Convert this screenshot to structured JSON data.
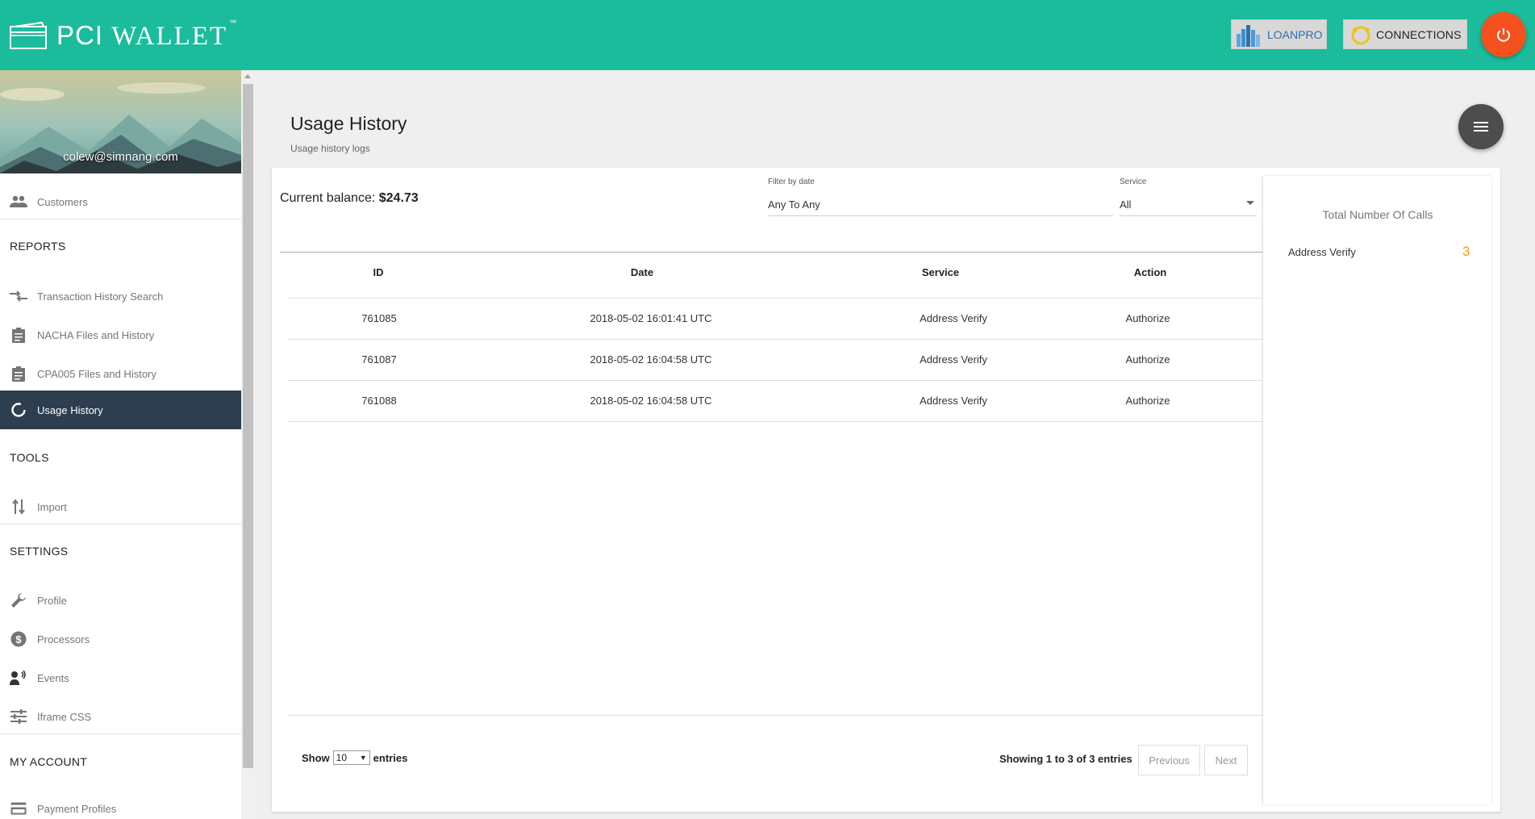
{
  "app": {
    "logo_text_a": "PCI",
    "logo_text_b": "WALLET",
    "logo_tm": "™"
  },
  "topbar": {
    "loanpro_label": "LOANPRO",
    "connections_label": "CONNECTIONS",
    "power_icon": "power-icon",
    "colors": {
      "bar": "#1abc9c",
      "power": "#f4511e"
    }
  },
  "sidebar": {
    "email": "colew@simnang.com",
    "items": {
      "customers": "Customers",
      "reports_head": "REPORTS",
      "transaction_history": "Transaction History Search",
      "nacha": "NACHA Files and History",
      "cpa005": "CPA005 Files and History",
      "usage_history": "Usage History",
      "tools_head": "TOOLS",
      "import": "Import",
      "settings_head": "SETTINGS",
      "profile": "Profile",
      "processors": "Processors",
      "events": "Events",
      "iframe_css": "Iframe CSS",
      "account_head": "MY ACCOUNT",
      "payment_profiles": "Payment Profiles"
    },
    "active_color": "#2c3e50"
  },
  "main": {
    "title": "Usage History",
    "subtitle": "Usage history logs",
    "balance_label": "Current balance:",
    "balance_value": "$24.73",
    "filter_date_label": "Filter by date",
    "filter_date_value": "Any To Any",
    "service_label": "Service",
    "service_value": "All",
    "table": {
      "headers": {
        "id": "ID",
        "date": "Date",
        "service": "Service",
        "action": "Action"
      },
      "rows": [
        {
          "id": "761085",
          "date": "2018-05-02 16:01:41 UTC",
          "service": "Address Verify",
          "action": "Authorize"
        },
        {
          "id": "761087",
          "date": "2018-05-02 16:04:58 UTC",
          "service": "Address Verify",
          "action": "Authorize"
        },
        {
          "id": "761088",
          "date": "2018-05-02 16:04:58 UTC",
          "service": "Address Verify",
          "action": "Authorize"
        }
      ]
    },
    "show_label": "Show",
    "page_length": "10",
    "entries_label": "entries",
    "showing_text": "Showing 1 to 3 of 3 entries",
    "prev_label": "Previous",
    "next_label": "Next"
  },
  "stats": {
    "title": "Total Number Of Calls",
    "label": "Address Verify",
    "value": "3",
    "value_color": "#ff9800"
  }
}
